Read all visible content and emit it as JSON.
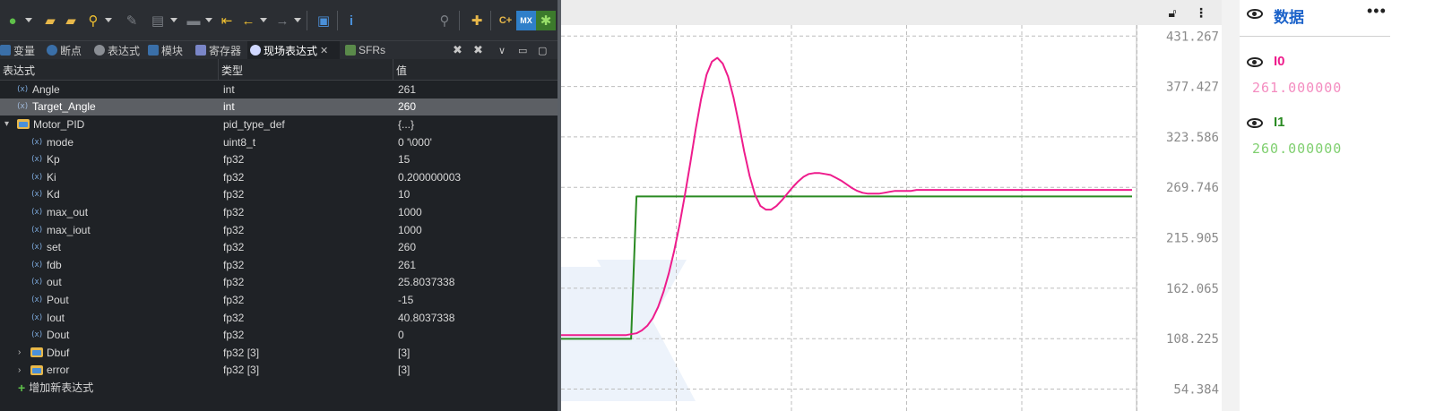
{
  "ide": {
    "tabs": [
      {
        "label": "变量",
        "icon": "variables-icon",
        "active": false
      },
      {
        "label": "断点",
        "icon": "breakpoints-icon",
        "active": false
      },
      {
        "label": "表达式",
        "icon": "expressions-icon",
        "active": false
      },
      {
        "label": "模块",
        "icon": "modules-icon",
        "active": false
      },
      {
        "label": "寄存器",
        "icon": "registers-icon",
        "active": false
      },
      {
        "label": "现场表达式",
        "icon": "live-expressions-icon",
        "active": true
      },
      {
        "label": "SFRs",
        "icon": "sfrs-icon",
        "active": false
      }
    ],
    "close_tab": "✕",
    "columns": {
      "expression": "表达式",
      "type": "类型",
      "value": "值"
    },
    "rows": [
      {
        "name": "Angle",
        "type": "int",
        "value": "261"
      },
      {
        "name": "Target_Angle",
        "type": "int",
        "value": "260"
      },
      {
        "name": "Motor_PID",
        "type": "pid_type_def",
        "value": "{...}"
      },
      {
        "name": "mode",
        "type": "uint8_t",
        "value": "0 '\\000'"
      },
      {
        "name": "Kp",
        "type": "fp32",
        "value": "15"
      },
      {
        "name": "Ki",
        "type": "fp32",
        "value": "0.200000003"
      },
      {
        "name": "Kd",
        "type": "fp32",
        "value": "10"
      },
      {
        "name": "max_out",
        "type": "fp32",
        "value": "1000"
      },
      {
        "name": "max_iout",
        "type": "fp32",
        "value": "1000"
      },
      {
        "name": "set",
        "type": "fp32",
        "value": "260"
      },
      {
        "name": "fdb",
        "type": "fp32",
        "value": "261"
      },
      {
        "name": "out",
        "type": "fp32",
        "value": "25.8037338"
      },
      {
        "name": "Pout",
        "type": "fp32",
        "value": "-15"
      },
      {
        "name": "Iout",
        "type": "fp32",
        "value": "40.8037338"
      },
      {
        "name": "Dout",
        "type": "fp32",
        "value": "0"
      },
      {
        "name": "Dbuf",
        "type": "fp32 [3]",
        "value": "[3]"
      },
      {
        "name": "error",
        "type": "fp32 [3]",
        "value": "[3]"
      }
    ],
    "add_expression": "增加新表达式",
    "toolbar_icons": [
      "debug-run-icon",
      "open-folder-icon",
      "search-file-icon",
      "search-icon",
      "edit-icon",
      "copy-icon",
      "save-icon",
      "back-icon",
      "back-arrow-icon",
      "forward-arrow-icon",
      "window-icon",
      "info-icon"
    ],
    "right_toolbar_icons": [
      "search-icon",
      "new-icon",
      "cpp-icon",
      "mx-icon",
      "debug-bug-icon"
    ],
    "colors": {
      "background": "#1f2226",
      "selected_row": "#5c5f64",
      "text": "#d8d8d8"
    }
  },
  "chart_data": {
    "type": "line",
    "title": "",
    "xlabel": "",
    "ylabel": "",
    "y_ticks": [
      "431.267",
      "377.427",
      "323.586",
      "269.746",
      "215.905",
      "162.065",
      "108.225",
      "54.384"
    ],
    "y_tick_values": [
      431.267,
      377.427,
      323.586,
      269.746,
      215.905,
      162.065,
      108.225,
      54.384
    ],
    "ylim": [
      31,
      443
    ],
    "grid": true,
    "legend": "right-panel",
    "x": [
      0,
      6,
      12,
      18,
      24,
      30,
      36,
      42,
      48,
      54,
      60,
      66,
      72,
      78,
      84,
      90,
      96,
      102,
      108,
      114,
      120,
      126,
      132,
      138,
      144,
      150,
      156,
      162,
      168,
      174,
      180,
      186,
      192,
      198,
      204,
      210,
      216,
      222,
      228,
      234,
      240,
      246,
      252,
      258,
      264,
      270,
      276,
      282,
      288,
      294,
      300,
      306,
      312,
      318,
      324,
      330,
      336,
      342,
      348,
      354,
      360,
      366,
      372,
      378,
      384,
      390,
      396,
      402,
      408,
      414,
      420,
      426,
      432,
      438,
      444,
      450,
      456,
      462,
      468,
      474,
      480,
      486,
      492,
      498,
      504,
      510,
      516,
      522,
      528,
      534,
      540,
      546,
      552,
      558,
      564,
      570,
      576,
      582,
      588,
      594,
      600,
      606,
      612,
      618,
      624,
      630,
      636
    ],
    "series": [
      {
        "name": "I0",
        "color": "#ee1c8c",
        "values": [
          112,
          112,
          112,
          112,
          112,
          112,
          112,
          112,
          112,
          112,
          112,
          112,
          112,
          113,
          114,
          117,
          122,
          130,
          142,
          158,
          178,
          202,
          230,
          262,
          296,
          332,
          364,
          390,
          404,
          408,
          402,
          388,
          366,
          338,
          308,
          282,
          262,
          250,
          246,
          246,
          250,
          256,
          263,
          270,
          276,
          281,
          284,
          285,
          285,
          284,
          283,
          280,
          277,
          273,
          269,
          266,
          264,
          263,
          263,
          263,
          264,
          265,
          266,
          266,
          266,
          266,
          267,
          267,
          267,
          267,
          267,
          267,
          267,
          267,
          267,
          267,
          267,
          267,
          267,
          267,
          267,
          267,
          267,
          267,
          267,
          267,
          267,
          267,
          267,
          267,
          267,
          267,
          267,
          267,
          267,
          267,
          267,
          267,
          267,
          267,
          267,
          267,
          267,
          267,
          267,
          267,
          267
        ]
      },
      {
        "name": "I1",
        "color": "#2a8a22",
        "values": [
          108,
          108,
          108,
          108,
          108,
          108,
          108,
          108,
          108,
          108,
          108,
          108,
          108,
          108,
          260,
          260,
          260,
          260,
          260,
          260,
          260,
          260,
          260,
          260,
          260,
          260,
          260,
          260,
          260,
          260,
          260,
          260,
          260,
          260,
          260,
          260,
          260,
          260,
          260,
          260,
          260,
          260,
          260,
          260,
          260,
          260,
          260,
          260,
          260,
          260,
          260,
          260,
          260,
          260,
          260,
          260,
          260,
          260,
          260,
          260,
          260,
          260,
          260,
          260,
          260,
          260,
          260,
          260,
          260,
          260,
          260,
          260,
          260,
          260,
          260,
          260,
          260,
          260,
          260,
          260,
          260,
          260,
          260,
          260,
          260,
          260,
          260,
          260,
          260,
          260,
          260,
          260,
          260,
          260,
          260,
          260,
          260,
          260,
          260,
          260,
          260,
          260,
          260,
          260,
          260,
          260,
          260
        ]
      }
    ]
  },
  "data_panel": {
    "title": "数据",
    "more": "•••",
    "series": [
      {
        "name": "I0",
        "value": "261.000000",
        "color": "#ee1c8c",
        "value_color": "#f48cc0"
      },
      {
        "name": "I1",
        "value": "260.000000",
        "color": "#2a8a22",
        "value_color": "#7fcf6f"
      }
    ]
  },
  "chart_toolbar": [
    "unlock-icon",
    "more-vertical-icon"
  ],
  "colors": {
    "accent": "#1b62c9",
    "grid": "#bdbdbd"
  }
}
